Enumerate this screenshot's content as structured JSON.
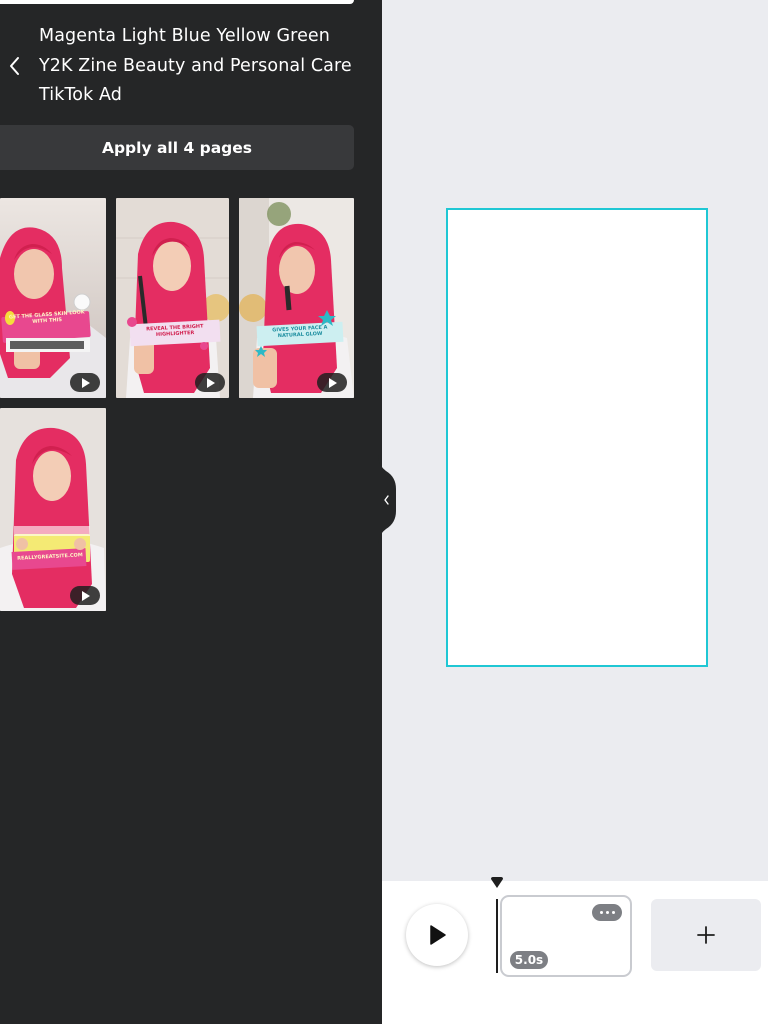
{
  "panel": {
    "title": "Magenta Light Blue Yellow Green Y2K Zine Beauty and Personal Care TikTok Ad",
    "back_icon": "chevron-left-icon",
    "apply_label": "Apply all 4 pages"
  },
  "thumbnails": [
    {
      "caption": "GET THE GLASS SKIN LOOK WITH THIS",
      "banner_color": "#e8488f",
      "play_icon": "play-icon"
    },
    {
      "caption": "REVEAL THE BRIGHT HIGHLIGHTER",
      "banner_color": "#f2dff0",
      "play_icon": "play-icon"
    },
    {
      "caption": "GIVES YOUR FACE A NATURAL GLOW",
      "banner_color": "#cdeff1",
      "play_icon": "play-icon"
    },
    {
      "caption": "REALLYGREATSITE.COM",
      "banner_color": "#e8488f",
      "play_icon": "play-icon"
    }
  ],
  "canvas": {
    "border_color": "#1fc7d4"
  },
  "timeline": {
    "play_icon": "play-icon",
    "clip_duration": "5.0s",
    "clip_menu_icon": "more-horizontal-icon",
    "add_icon": "plus-icon"
  },
  "colors": {
    "panel_bg": "#252627",
    "workspace_bg": "#ebecf0",
    "accent": "#1fc7d4",
    "hair": "#e42d62"
  }
}
